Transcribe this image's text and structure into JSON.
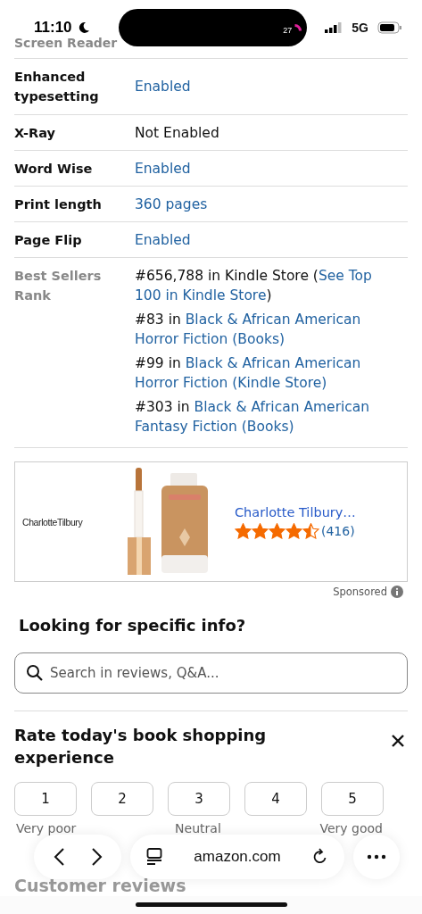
{
  "status_bar": {
    "time": "11:10",
    "island_badge": "27",
    "network": "5G"
  },
  "details": [
    {
      "label": "Screen Reader",
      "muted_label": true
    },
    {
      "label": "Enhanced typesetting",
      "muted_label": false,
      "value": "Enabled",
      "kind": "link"
    },
    {
      "label": "X-Ray",
      "muted_label": false,
      "value": "Not Enabled",
      "kind": "plain"
    },
    {
      "label": "Word Wise",
      "muted_label": false,
      "value": "Enabled",
      "kind": "link"
    },
    {
      "label": "Print length",
      "muted_label": false,
      "value": "360 pages",
      "kind": "link"
    },
    {
      "label": "Page Flip",
      "muted_label": false,
      "value": "Enabled",
      "kind": "link"
    }
  ],
  "best_sellers": {
    "label": "Best Sellers Rank",
    "ranks": [
      {
        "text": "#656,788 in Kindle Store (",
        "link_lines": [
          "See Top",
          "100 in Kindle Store"
        ],
        "after": ")"
      },
      {
        "text": "#83 in ",
        "link_lines": [
          "Black & African American",
          "Horror Fiction (Books)"
        ]
      },
      {
        "text": "#99 in ",
        "link_lines": [
          "Black & African American",
          "Horror Fiction (Kindle Store)"
        ]
      },
      {
        "text": "#303 in ",
        "link_lines": [
          "Black & African American",
          "Fantasy Fiction (Books)"
        ]
      }
    ]
  },
  "ad": {
    "brand": "CharlotteTilbury",
    "title": "Charlotte Tilbury…",
    "stars": 4.5,
    "count": "(416)",
    "sponsored": "Sponsored"
  },
  "info": {
    "heading": "Looking for specific info?",
    "placeholder": "Search in reviews, Q&A..."
  },
  "rating": {
    "heading": "Rate today's book shopping experience",
    "buttons": [
      "1",
      "2",
      "3",
      "4",
      "5"
    ],
    "labels": [
      "Very poor",
      "Neutral",
      "Very good"
    ]
  },
  "browser": {
    "address": "amazon.com"
  },
  "next_section": "Customer reviews"
}
